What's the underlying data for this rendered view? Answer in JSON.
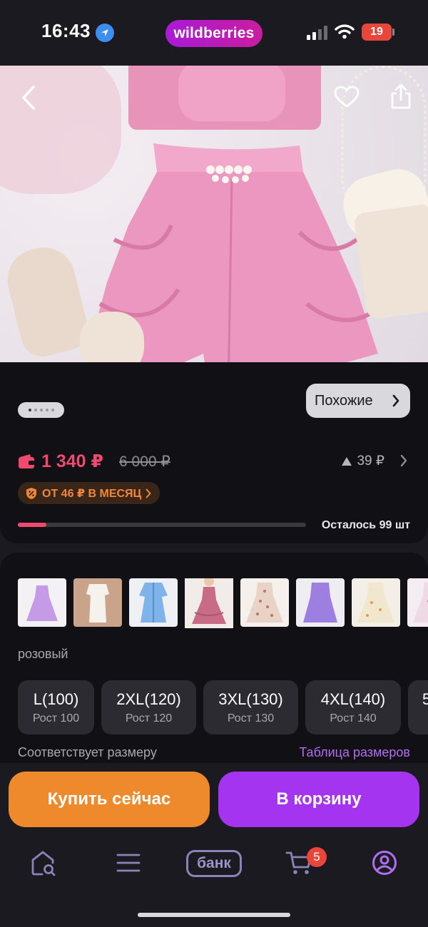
{
  "status_bar": {
    "time": "16:43",
    "app_badge": "wildberries",
    "battery": "19"
  },
  "product": {
    "similar_label": "Похожие",
    "price": "1 340 ₽",
    "old_price": "6 000 ₽",
    "price_delta": "39 ₽",
    "installment_label": "ОТ 46 ₽ В МЕСЯЦ",
    "remaining_label": "Осталось 99 шт",
    "image_index": 1,
    "image_count": 5
  },
  "variants": {
    "thumbnail_icons": [
      "lilac-tulle-dress-icon",
      "white-dress-icon",
      "blue-blazer-dress-icon",
      "pink-ruffle-dress-icon",
      "floral-dress-icon",
      "purple-dress-icon",
      "cream-floral-dress-icon",
      "pink-floral-dress-icon"
    ],
    "selected_index": 3,
    "color_label": "розовый",
    "sizes": [
      {
        "label": "L(100)",
        "sub": "Рост 100"
      },
      {
        "label": "2XL(120)",
        "sub": "Рост 120"
      },
      {
        "label": "3XL(130)",
        "sub": "Рост 130"
      },
      {
        "label": "4XL(140)",
        "sub": "Рост 140"
      },
      {
        "label": "5",
        "sub": ""
      }
    ],
    "fit_label": "Соответствует размеру",
    "size_table_label": "Таблица размеров"
  },
  "actions": {
    "buy_now_label": "Купить сейчас",
    "add_to_cart_label": "В корзину"
  },
  "nav": {
    "bank_label": "банк",
    "cart_badge": "5"
  },
  "colors": {
    "accent_price": "#f04970",
    "buy_now": "#ef8a2c",
    "cart": "#a534f0",
    "link": "#b06ef0"
  }
}
